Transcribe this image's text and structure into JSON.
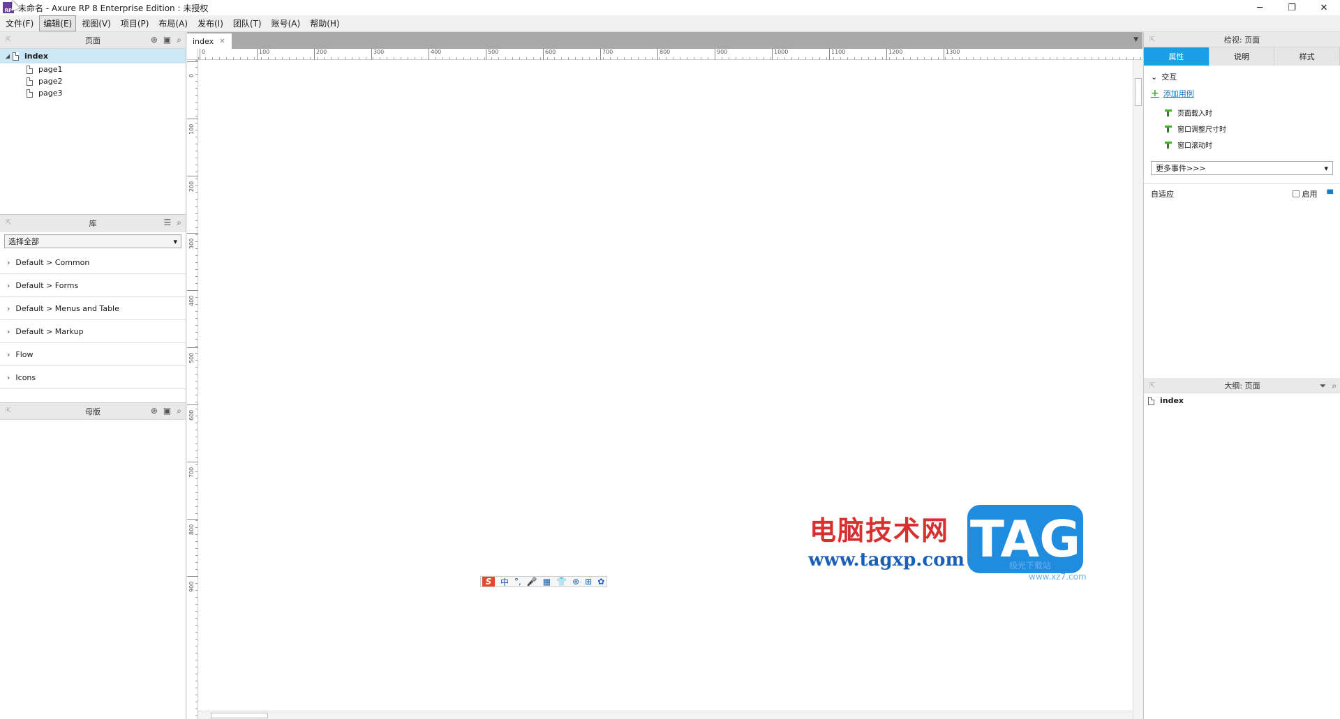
{
  "window": {
    "logo_text": "RP",
    "title": "未命名 - Axure RP 8 Enterprise Edition : 未授权",
    "controls": [
      "─",
      "❐",
      "✕"
    ]
  },
  "menubar": [
    {
      "label": "文件(F)",
      "active": false
    },
    {
      "label": "编辑(E)",
      "active": true
    },
    {
      "label": "视图(V)",
      "active": false
    },
    {
      "label": "项目(P)",
      "active": false
    },
    {
      "label": "布局(A)",
      "active": false
    },
    {
      "label": "发布(I)",
      "active": false
    },
    {
      "label": "团队(T)",
      "active": false
    },
    {
      "label": "账号(A)",
      "active": false
    },
    {
      "label": "帮助(H)",
      "active": false
    }
  ],
  "pages_panel": {
    "title": "页面",
    "root": "index",
    "children": [
      "page1",
      "page2",
      "page3"
    ]
  },
  "library_panel": {
    "title": "库",
    "select_value": "选择全部",
    "items": [
      "Default > Common",
      "Default > Forms",
      "Default > Menus and Table",
      "Default > Markup",
      "Flow",
      "Icons"
    ]
  },
  "masters_panel": {
    "title": "母版"
  },
  "canvas": {
    "tab_label": "index",
    "hruler_labels": [
      "0",
      "100",
      "200",
      "300",
      "400",
      "500",
      "600",
      "700",
      "800",
      "900",
      "1000",
      "1100",
      "1200",
      "1300"
    ],
    "vruler_labels": [
      "0",
      "100",
      "200",
      "300",
      "400",
      "500",
      "600",
      "700",
      "800",
      "900"
    ]
  },
  "inspector": {
    "title": "检视: 页面",
    "tabs": [
      "属性",
      "说明",
      "样式"
    ],
    "active_tab": 0,
    "interaction_title": "交互",
    "add_case": "添加用例",
    "events": [
      "页面载入时",
      "窗口调整尺寸时",
      "窗口滚动时"
    ],
    "more_events": "更多事件>>>",
    "adaptive_label": "自适应",
    "enable_label": "启用"
  },
  "outline": {
    "title": "大纲: 页面",
    "item": "index"
  },
  "watermark": {
    "cn": "电脑技术网",
    "url": "www.tagxp.com",
    "tag": "TAG",
    "small1": "极光下载站",
    "small2": "www.xz7.com"
  },
  "ime": {
    "s": "S",
    "glyphs": [
      "中",
      "°,",
      "🎤",
      "▦",
      "👕",
      "⊕",
      "⊞",
      "✿"
    ]
  },
  "colors": {
    "accent_blue": "#1a9ee5",
    "selected_row": "#cce8f7",
    "event_green": "#4caf2c",
    "watermark_red": "#d63030",
    "watermark_blue": "#1f8ce0"
  }
}
